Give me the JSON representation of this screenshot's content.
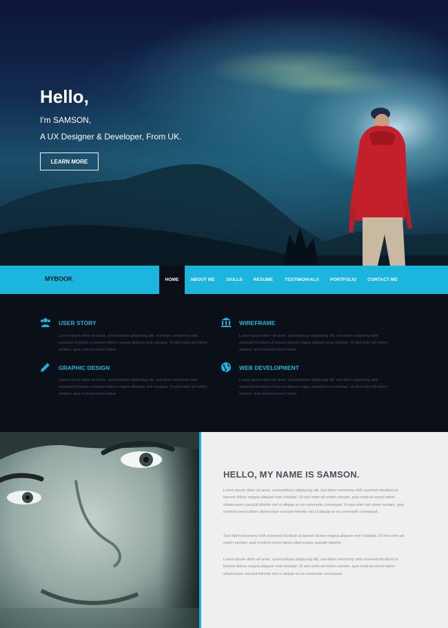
{
  "hero": {
    "title": "Hello,",
    "subtitle1": "I'm SAMSON,",
    "subtitle2": "A UX Designer & Developer, From UK.",
    "button_label": "LEARN MORE"
  },
  "navbar": {
    "brand": "MYBOOK",
    "items": [
      {
        "label": "HOME",
        "active": true
      },
      {
        "label": "ABOUT ME",
        "active": false
      },
      {
        "label": "SKILLS",
        "active": false
      },
      {
        "label": "RESUME",
        "active": false
      },
      {
        "label": "TESTIMONIALS",
        "active": false
      },
      {
        "label": "PORTFOLIO",
        "active": false
      },
      {
        "label": "CONTACT ME",
        "active": false
      }
    ]
  },
  "services": [
    {
      "title": "USER STORY",
      "icon": "users-icon",
      "text": "Lorem ipsum dolor sit amet, consectetuer adipiscing elit, sed diam nonummy nibh euismod tincidunt ut laoreet dolore magna aliquam erat volutpat. Ut wisi enim ad minim veniam, quis nostrud exerci tation"
    },
    {
      "title": "WIREFRAME",
      "icon": "bank-icon",
      "text": "Lorem ipsum dolor sit amet, consectetuer adipiscing elit, sed diam nonummy nibh euismod tincidunt ut laoreet dolore magna aliquam erat volutpat. Ut wisi enim ad minim veniam, quis nostrud exerci tation"
    },
    {
      "title": "GRAPHIC DESIGN",
      "icon": "pencil-icon",
      "text": "Lorem ipsum dolor sit amet, consectetuer adipiscing elit, sed diam nonummy nibh euismod tincidunt ut laoreet dolore magna aliquam erat volutpat. Ut wisi enim ad minim veniam, quis nostrud exerci tation"
    },
    {
      "title": "WEB DEVELOPMENT",
      "icon": "globe-icon",
      "text": "Lorem ipsum dolor sit amet, consectetuer adipiscing elit, sed diam nonummy nibh euismod tincidunt ut laoreet dolore magna aliquam erat volutpat. Ut wisi enim ad minim veniam, quis nostrud exerci tation"
    }
  ],
  "about": {
    "title": "HELLO, MY NAME IS SAMSON.",
    "paragraphs": [
      "Lorem ipsum dolor sit amet, consectetuer adipiscing elit, sed diam nonummy nibh euismod tincidunt ut laoreet dolore magna aliquam erat volutpat. Ut wisi enim ad minim veniam, quis nostrud exerci tation ullamcorper suscipit lobortis nisl ut aliquip ex ea commodo consequat. Ut wisi enim ad minim veniam, quis nostrud exerci tation ullamcorper suscipit lobortis nisl ut aliquip ex ea commodo consequat.",
      "Sed diam nonummy nibh euismod tincidunt ut laoreet dolore magna aliquam erat volutpat. Ut wisi enim ad minim veniam, quis nostrud exerci tation ullamcorper suscipit lobortis.",
      "Lorem ipsum dolor sit amet, consectetuer adipiscing elit, sed diam nonummy nibh euismod tincidunt ut laoreet dolore magna aliquam erat volutpat. Ut wisi enim ad minim veniam, quis nostrud exerci tation ullamcorper suscipit lobortis nisl ut aliquip ex ea commodo consequat."
    ]
  },
  "colors": {
    "accent": "#1bb5de",
    "dark_bg": "#0b0f18",
    "light_bg": "#efefef"
  }
}
